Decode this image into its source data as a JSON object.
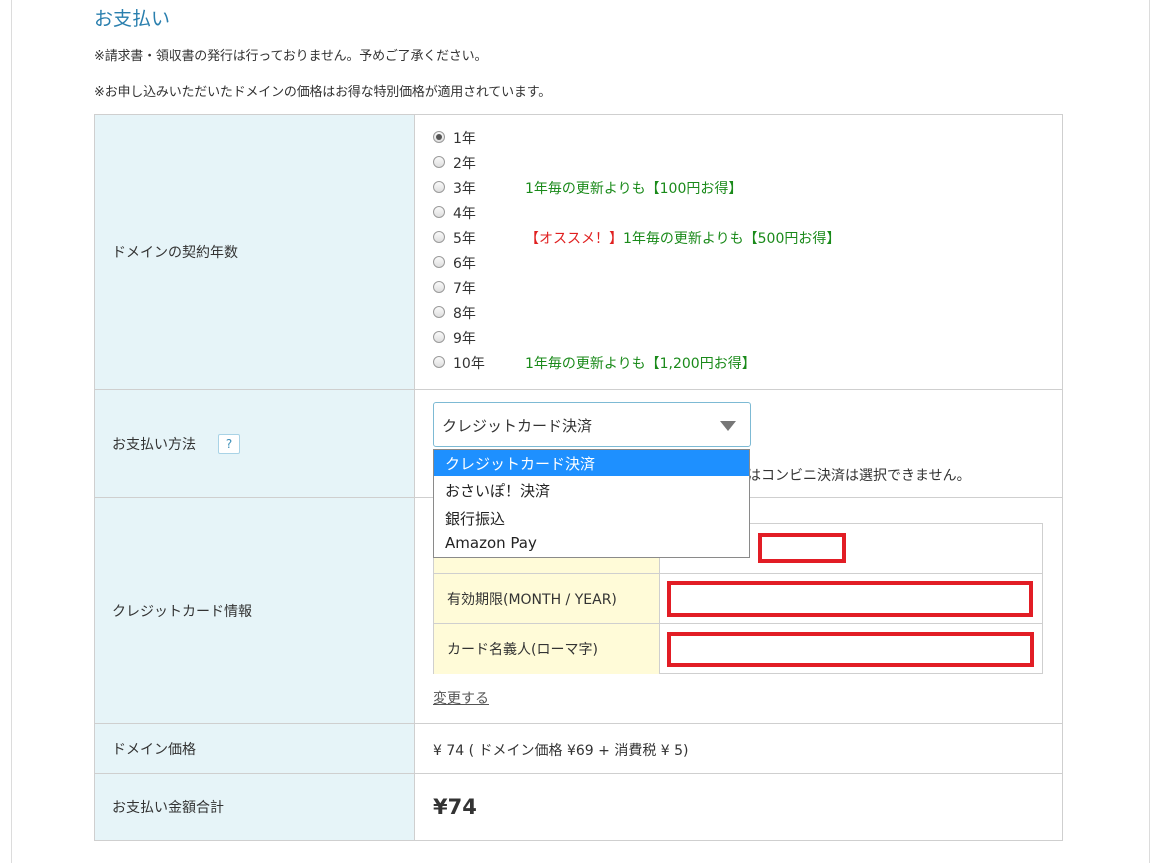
{
  "page": {
    "title": "お支払い",
    "note1": "※請求書・領収書の発行は行っておりません。予めご了承ください。",
    "note2": "※お申し込みいただいたドメインの価格はお得な特別価格が適用されています。"
  },
  "rows": {
    "contract_years_label": "ドメインの契約年数",
    "payment_method_label": "お支払い方法",
    "help_icon": "?",
    "credit_card_label": "クレジットカード情報",
    "domain_price_label": "ドメイン価格",
    "total_label": "お支払い金額合計"
  },
  "years": [
    {
      "label": "1年",
      "checked": true,
      "promo_red": "",
      "promo": ""
    },
    {
      "label": "2年",
      "checked": false,
      "promo_red": "",
      "promo": ""
    },
    {
      "label": "3年",
      "checked": false,
      "promo_red": "",
      "promo": "1年毎の更新よりも【100円お得】"
    },
    {
      "label": "4年",
      "checked": false,
      "promo_red": "",
      "promo": ""
    },
    {
      "label": "5年",
      "checked": false,
      "promo_red": "【オススメ！】",
      "promo": "1年毎の更新よりも【500円お得】"
    },
    {
      "label": "6年",
      "checked": false,
      "promo_red": "",
      "promo": ""
    },
    {
      "label": "7年",
      "checked": false,
      "promo_red": "",
      "promo": ""
    },
    {
      "label": "8年",
      "checked": false,
      "promo_red": "",
      "promo": ""
    },
    {
      "label": "9年",
      "checked": false,
      "promo_red": "",
      "promo": ""
    },
    {
      "label": "10年",
      "checked": false,
      "promo_red": "",
      "promo": "1年毎の更新よりも【1,200円お得】"
    }
  ],
  "payment": {
    "selected": "クレジットカード決済",
    "options": [
      "クレジットカード決済",
      "おさいぽ！決済",
      "銀行振込",
      "Amazon Pay"
    ],
    "partial_note": "はコンビニ決済は選択できません。"
  },
  "credit_card": {
    "expiry_label": "有効期限(MONTH / YEAR)",
    "holder_label": "カード名義人(ローマ字)",
    "change_link": "変更する"
  },
  "price": {
    "domain_price": "¥ 74 ( ドメイン価格 ¥69 + 消費税 ¥ 5)",
    "total": "¥74"
  },
  "colors": {
    "accent": "#2a7fae",
    "header_bg": "#e6f4f8",
    "label_bg": "#fffbd8",
    "promo_green": "#1a8a1a",
    "promo_red": "#e02020",
    "highlight_red": "#e21d25",
    "dropdown_selected": "#1e90ff"
  }
}
